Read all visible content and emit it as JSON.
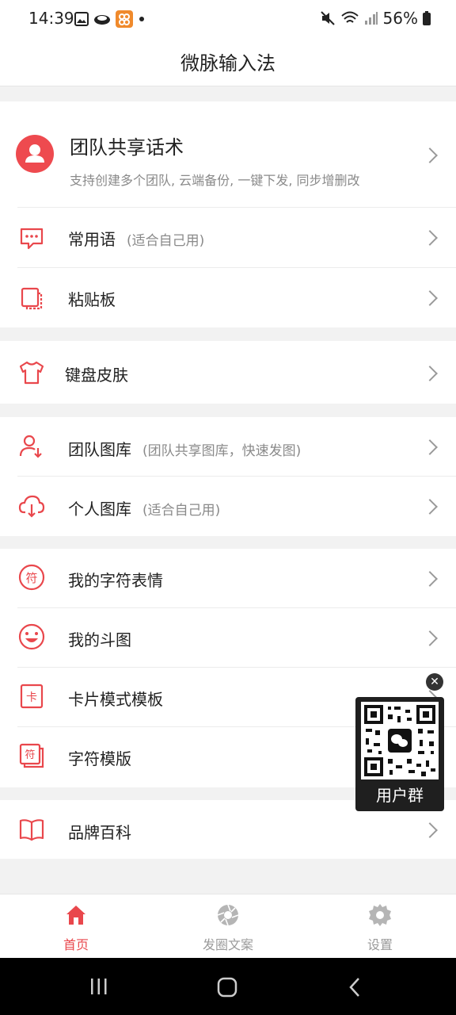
{
  "status_bar": {
    "time": "14:39",
    "battery": "56%"
  },
  "header": {
    "title": "微脉输入法"
  },
  "team": {
    "title": "团队共享话术",
    "description": "支持创建多个团队, 云端备份, 一键下发, 同步增删改"
  },
  "menu": {
    "phrases": {
      "label": "常用语",
      "sub": "(适合自己用)"
    },
    "clipboard": {
      "label": "粘贴板"
    },
    "skin": {
      "label": "键盘皮肤"
    },
    "team_gallery": {
      "label": "团队图库",
      "sub": "(团队共享图库，快速发图)"
    },
    "personal_gallery": {
      "label": "个人图库",
      "sub": "(适合自己用)"
    },
    "char_emoji": {
      "label": "我的字符表情"
    },
    "meme": {
      "label": "我的斗图"
    },
    "card_template": {
      "label": "卡片模式模板"
    },
    "char_template": {
      "label": "字符模版"
    },
    "brand": {
      "label": "品牌百科"
    }
  },
  "icons": {
    "char_glyph": "符",
    "card_glyph": "卡"
  },
  "qr_popup": {
    "label": "用户群"
  },
  "tabbar": {
    "home": "首页",
    "moments": "发圈文案",
    "settings": "设置"
  },
  "colors": {
    "accent": "#e9474c",
    "background": "#f2f2f2"
  }
}
